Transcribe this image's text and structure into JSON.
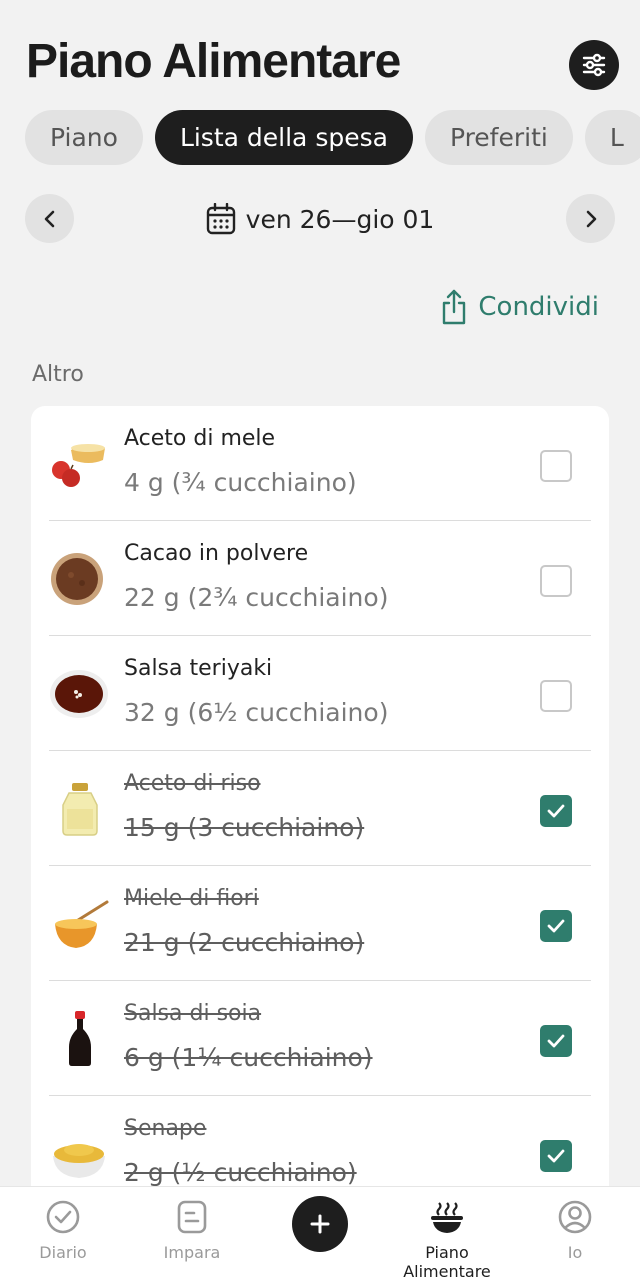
{
  "header": {
    "title": "Piano Alimentare"
  },
  "tabs": [
    {
      "label": "Piano",
      "active": false
    },
    {
      "label": "Lista della spesa",
      "active": true
    },
    {
      "label": "Preferiti",
      "active": false
    },
    {
      "label": "L",
      "active": false
    }
  ],
  "date_nav": {
    "range": "ven 26—gio 01"
  },
  "share": {
    "label": "Condividi"
  },
  "section": {
    "label": "Altro"
  },
  "items": [
    {
      "name": "Aceto di mele",
      "qty": "4 g (¾ cucchiaino)",
      "checked": false,
      "icon": "apple-vinegar-image"
    },
    {
      "name": "Cacao in polvere",
      "qty": "22 g (2¾ cucchiaino)",
      "checked": false,
      "icon": "cocoa-powder-image"
    },
    {
      "name": "Salsa teriyaki",
      "qty": "32 g (6½ cucchiaino)",
      "checked": false,
      "icon": "teriyaki-sauce-image"
    },
    {
      "name": "Aceto di riso",
      "qty": "15 g (3 cucchiaino)",
      "checked": true,
      "icon": "rice-vinegar-image"
    },
    {
      "name": "Miele di fiori",
      "qty": "21 g (2 cucchiaino)",
      "checked": true,
      "icon": "honey-image"
    },
    {
      "name": "Salsa di soia",
      "qty": "6 g (1¼ cucchiaino)",
      "checked": true,
      "icon": "soy-sauce-image"
    },
    {
      "name": "Senape",
      "qty": "2 g (½ cucchiaino)",
      "checked": true,
      "icon": "mustard-image"
    }
  ],
  "tabbar": {
    "diary": "Diario",
    "learn": "Impara",
    "plan": "Piano Alimentare",
    "me": "Io",
    "active": "plan"
  },
  "colors": {
    "accent": "#2f7d6d",
    "dark": "#1e1e1e",
    "background": "#f2f2f2"
  }
}
